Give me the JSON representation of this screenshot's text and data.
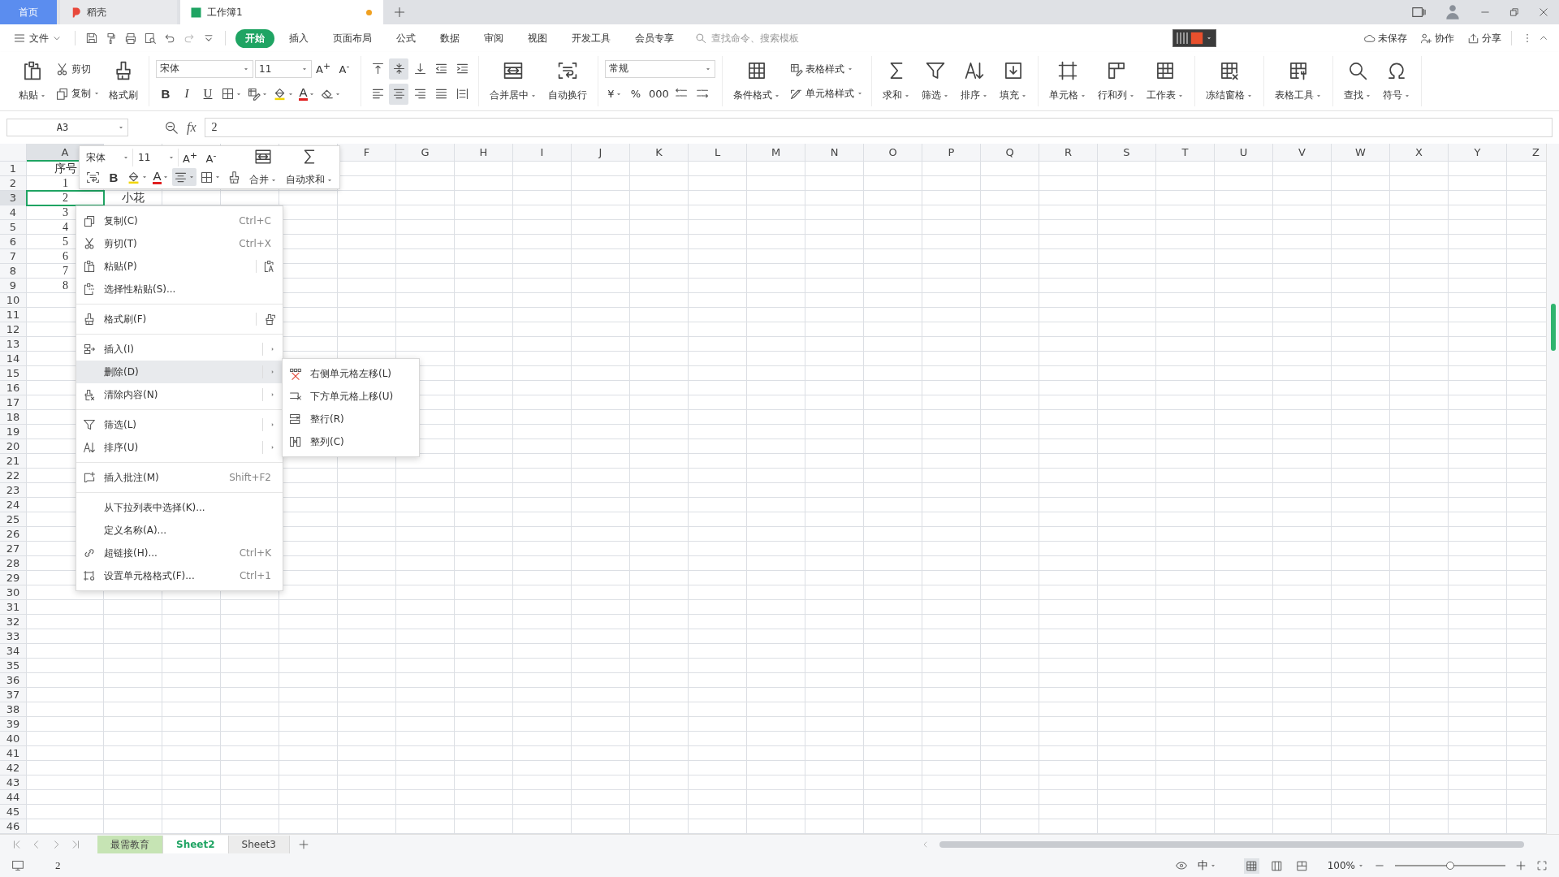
{
  "tabs": [
    {
      "kind": "home",
      "label": "首页",
      "selected": false
    },
    {
      "kind": "docer",
      "label": "稻壳",
      "selected": false
    },
    {
      "kind": "sheet",
      "label": "工作簿1",
      "selected": true,
      "unsaved": true
    }
  ],
  "menu": {
    "file": "文件",
    "ribbon_tabs": [
      {
        "label": "开始",
        "selected": true
      },
      {
        "label": "插入",
        "selected": false
      },
      {
        "label": "页面布局",
        "selected": false
      },
      {
        "label": "公式",
        "selected": false
      },
      {
        "label": "数据",
        "selected": false
      },
      {
        "label": "审阅",
        "selected": false
      },
      {
        "label": "视图",
        "selected": false
      },
      {
        "label": "开发工具",
        "selected": false
      },
      {
        "label": "会员专享",
        "selected": false
      }
    ],
    "search": {
      "placeholder": "查找命令、搜索模板"
    },
    "actions": [
      "未保存",
      "协作",
      "分享"
    ]
  },
  "ribbon": [
    {
      "items": [
        {
          "kind": "big",
          "label": "粘贴",
          "dropdown": true
        },
        {
          "kind": "smalls",
          "items": [
            {
              "label": "剪切",
              "dropdown": false
            },
            {
              "label": "复制",
              "dropdown": true
            }
          ]
        },
        {
          "kind": "big",
          "label": "格式刷",
          "dropdown": false
        }
      ]
    },
    {
      "rows": [
        [
          {
            "kind": "font",
            "value": "宋体"
          },
          {
            "kind": "size",
            "value": "11"
          },
          {
            "kind": "text",
            "label": "A$^{+}$",
            "dropdown": false
          },
          {
            "kind": "text",
            "label": "A$^{-}$",
            "dropdown": false
          }
        ],
        [
          {
            "kind": "bold",
            "label": "B",
            "dropdown": false
          },
          {
            "kind": "italic",
            "label": "I",
            "dropdown": false
          },
          {
            "kind": "underline",
            "label": "U",
            "dropdown": false
          },
          {
            "kind": "icon",
            "dropdown": true
          },
          {
            "kind": "icon",
            "dropdown": true
          },
          {
            "kind": "icon",
            "dropdown": true
          },
          {
            "kind": "font-color",
            "label": "A",
            "dropdown": true
          },
          {
            "kind": "icon",
            "dropdown": true
          }
        ]
      ]
    },
    {
      "rows": [
        [
          {
            "kind": "icon",
            "selected": false
          },
          {
            "kind": "icon",
            "selected": true
          },
          {
            "kind": "icon",
            "selected": false
          },
          {
            "kind": "icon",
            "selected": false
          },
          {
            "kind": "icon",
            "selected": false
          }
        ],
        [
          {
            "kind": "icon",
            "selected": false
          },
          {
            "kind": "icon",
            "selected": true
          },
          {
            "kind": "icon",
            "selected": false
          },
          {
            "kind": "icon",
            "selected": false
          },
          {
            "kind": "icon",
            "selected": false
          }
        ]
      ]
    },
    {
      "items": [
        {
          "kind": "big",
          "label": "合并居中",
          "dropdown": true
        },
        {
          "kind": "big",
          "label": "自动换行",
          "dropdown": false
        }
      ]
    },
    {
      "rows": [
        [
          {
            "kind": "format",
            "value": "常规"
          }
        ],
        [
          {
            "kind": "text",
            "label": "¥",
            "dropdown": true
          },
          {
            "kind": "text",
            "label": "%",
            "dropdown": false
          },
          {
            "kind": "text",
            "label": "000",
            "dropdown": false
          },
          {
            "kind": "icon",
            "dropdown": false
          },
          {
            "kind": "icon",
            "dropdown": false
          }
        ]
      ]
    },
    {
      "items": [
        {
          "kind": "big",
          "label": "条件格式",
          "dropdown": true
        },
        {
          "kind": "smalls",
          "items": [
            {
              "label": "表格样式",
              "dropdown": true
            },
            {
              "label": "单元格样式",
              "dropdown": true
            }
          ]
        }
      ]
    },
    {
      "items": [
        {
          "kind": "big",
          "label": "求和",
          "dropdown": true
        },
        {
          "kind": "big",
          "label": "筛选",
          "dropdown": true
        },
        {
          "kind": "big",
          "label": "排序",
          "dropdown": true
        },
        {
          "kind": "big",
          "label": "填充",
          "dropdown": true
        }
      ]
    },
    {
      "items": [
        {
          "kind": "big",
          "label": "单元格",
          "dropdown": true
        },
        {
          "kind": "big",
          "label": "行和列",
          "dropdown": true
        },
        {
          "kind": "big",
          "label": "工作表",
          "dropdown": true
        }
      ]
    },
    {
      "items": [
        {
          "kind": "big",
          "label": "冻结窗格",
          "dropdown": true
        }
      ]
    },
    {
      "items": [
        {
          "kind": "big",
          "label": "表格工具",
          "dropdown": true
        }
      ]
    },
    {
      "items": [
        {
          "kind": "big",
          "label": "查找",
          "dropdown": true
        },
        {
          "kind": "big",
          "label": "符号",
          "dropdown": true
        }
      ]
    }
  ],
  "formula_bar": {
    "name_box": "A3",
    "fx": "fx",
    "value": "2"
  },
  "columns": [
    {
      "label": "A",
      "selected": true
    },
    {
      "label": "F",
      "selected": false
    },
    {
      "label": "G",
      "selected": false
    },
    {
      "label": "H",
      "selected": false
    },
    {
      "label": "I",
      "selected": false
    },
    {
      "label": "J",
      "selected": false
    },
    {
      "label": "K",
      "selected": false
    },
    {
      "label": "L",
      "selected": false
    },
    {
      "label": "M",
      "selected": false
    },
    {
      "label": "N",
      "selected": false
    },
    {
      "label": "O",
      "selected": false
    },
    {
      "label": "P",
      "selected": false
    },
    {
      "label": "Q",
      "selected": false
    },
    {
      "label": "R",
      "selected": false
    },
    {
      "label": "S",
      "selected": false
    },
    {
      "label": "T",
      "selected": false
    },
    {
      "label": "U",
      "selected": false
    },
    {
      "label": "V",
      "selected": false
    },
    {
      "label": "W",
      "selected": false
    },
    {
      "label": "X",
      "selected": false
    },
    {
      "label": "Y",
      "selected": false
    },
    {
      "label": "Z",
      "selected": false
    }
  ],
  "rows": [
    {
      "number": "1",
      "selected": false,
      "cells": [
        "序号"
      ]
    },
    {
      "number": "2",
      "selected": false,
      "cells": [
        "1"
      ]
    },
    {
      "number": "3",
      "selected": true,
      "cells": [
        "2",
        "小花"
      ]
    },
    {
      "number": "4",
      "selected": false,
      "cells": [
        "3"
      ]
    },
    {
      "number": "5",
      "selected": false,
      "cells": [
        "4"
      ]
    },
    {
      "number": "6",
      "selected": false,
      "cells": [
        "5"
      ]
    },
    {
      "number": "7",
      "selected": false,
      "cells": [
        "6"
      ]
    },
    {
      "number": "8",
      "selected": false,
      "cells": [
        "7"
      ]
    },
    {
      "number": "9",
      "selected": false,
      "cells": [
        "8"
      ]
    },
    {
      "number": "10",
      "selected": false
    },
    {
      "number": "11",
      "selected": false
    },
    {
      "number": "12",
      "selected": false
    },
    {
      "number": "13",
      "selected": false
    },
    {
      "number": "14",
      "selected": false
    },
    {
      "number": "15",
      "selected": false
    },
    {
      "number": "16",
      "selected": false
    },
    {
      "number": "17",
      "selected": false
    },
    {
      "number": "18",
      "selected": false
    },
    {
      "number": "19",
      "selected": false
    },
    {
      "number": "20",
      "selected": false
    },
    {
      "number": "21",
      "selected": false
    },
    {
      "number": "22",
      "selected": false
    },
    {
      "number": "23",
      "selected": false
    },
    {
      "number": "24",
      "selected": false
    },
    {
      "number": "25",
      "selected": false
    },
    {
      "number": "26",
      "selected": false
    },
    {
      "number": "27",
      "selected": false
    },
    {
      "number": "28",
      "selected": false
    },
    {
      "number": "29",
      "selected": false
    },
    {
      "number": "30",
      "selected": false
    },
    {
      "number": "31",
      "selected": false
    },
    {
      "number": "32",
      "selected": false
    },
    {
      "number": "33",
      "selected": false
    },
    {
      "number": "34",
      "selected": false
    },
    {
      "number": "35",
      "selected": false
    },
    {
      "number": "36",
      "selected": false
    },
    {
      "number": "37",
      "selected": false
    },
    {
      "number": "38",
      "selected": false
    },
    {
      "number": "39",
      "selected": false
    },
    {
      "number": "40",
      "selected": false
    },
    {
      "number": "41",
      "selected": false
    },
    {
      "number": "42",
      "selected": false
    },
    {
      "number": "43",
      "selected": false
    },
    {
      "number": "44",
      "selected": false
    },
    {
      "number": "45",
      "selected": false
    },
    {
      "number": "46",
      "selected": false
    }
  ],
  "mini_toolbar": {
    "font": {
      "kind": "font",
      "value": "宋体"
    },
    "size": {
      "kind": "size",
      "value": "11"
    },
    "top_tools": [
      {
        "kind": "text",
        "label": "A$^{+}$",
        "dropdown": false,
        "selected": false
      },
      {
        "kind": "text",
        "label": "A$^{-}$",
        "dropdown": false,
        "selected": false
      }
    ],
    "bottom_tools": [
      {
        "kind": "icon",
        "dropdown": false,
        "selected": false
      },
      {
        "kind": "bold",
        "label": "B",
        "dropdown": false,
        "selected": false
      },
      {
        "kind": "icon",
        "dropdown": true,
        "selected": false
      },
      {
        "kind": "font-color",
        "label": "A",
        "dropdown": true,
        "selected": false
      },
      {
        "kind": "icon",
        "dropdown": true,
        "selected": true
      },
      {
        "kind": "icon",
        "dropdown": true,
        "selected": false
      },
      {
        "kind": "icon",
        "dropdown": false,
        "selected": false
      }
    ],
    "buttons": [
      {
        "label": "合并",
        "dropdown": true
      },
      {
        "label": "自动求和",
        "dropdown": true
      }
    ]
  },
  "context_menu": {
    "items": [
      {
        "kind": "item",
        "label": "复制(C)",
        "shortcut": "Ctrl+C",
        "submenu": false,
        "selected": false
      },
      {
        "kind": "item",
        "label": "剪切(T)",
        "shortcut": "Ctrl+X",
        "submenu": false,
        "selected": false
      },
      {
        "kind": "item",
        "label": "粘贴(P)",
        "submenu": false,
        "selected": false
      },
      {
        "kind": "item",
        "label": "选择性粘贴(S)...",
        "submenu": false,
        "selected": false
      },
      {
        "kind": "separator"
      },
      {
        "kind": "item",
        "label": "格式刷(F)",
        "submenu": false,
        "selected": false
      },
      {
        "kind": "separator"
      },
      {
        "kind": "item",
        "label": "插入(I)",
        "submenu": true,
        "selected": false
      },
      {
        "kind": "item",
        "label": "删除(D)",
        "submenu": true,
        "selected": true
      },
      {
        "kind": "item",
        "label": "清除内容(N)",
        "submenu": true,
        "selected": false
      },
      {
        "kind": "separator"
      },
      {
        "kind": "item",
        "label": "筛选(L)",
        "submenu": true,
        "selected": false
      },
      {
        "kind": "item",
        "label": "排序(U)",
        "submenu": true,
        "selected": false
      },
      {
        "kind": "separator"
      },
      {
        "kind": "item",
        "label": "插入批注(M)",
        "shortcut": "Shift+F2",
        "submenu": false,
        "selected": false
      },
      {
        "kind": "separator"
      },
      {
        "kind": "item",
        "label": "从下拉列表中选择(K)...",
        "submenu": false,
        "selected": false
      },
      {
        "kind": "item",
        "label": "定义名称(A)...",
        "submenu": false,
        "selected": false
      },
      {
        "kind": "item",
        "label": "超链接(H)...",
        "shortcut": "Ctrl+K",
        "submenu": false,
        "selected": false
      },
      {
        "kind": "item",
        "label": "设置单元格格式(F)...",
        "shortcut": "Ctrl+1",
        "submenu": false,
        "selected": false
      }
    ]
  },
  "submenu": {
    "items": [
      {
        "label": "右侧单元格左移(L)",
        "selected": false
      },
      {
        "label": "下方单元格上移(U)",
        "selected": false
      },
      {
        "label": "整行(R)",
        "selected": false
      },
      {
        "label": "整列(C)",
        "selected": false
      }
    ]
  },
  "sheet_tabs": [
    {
      "label": "最需教育",
      "selected": false,
      "color": "#c6e4b4"
    },
    {
      "label": "Sheet2",
      "selected": true
    },
    {
      "label": "Sheet3",
      "selected": false
    }
  ],
  "status_bar": {
    "value": "2",
    "input_mode": "中",
    "views": [
      {
        "selected": true
      },
      {
        "selected": false
      },
      {
        "selected": false
      }
    ],
    "zoom": "100%",
    "zoom_slider": {
      "level": 0.5
    }
  }
}
